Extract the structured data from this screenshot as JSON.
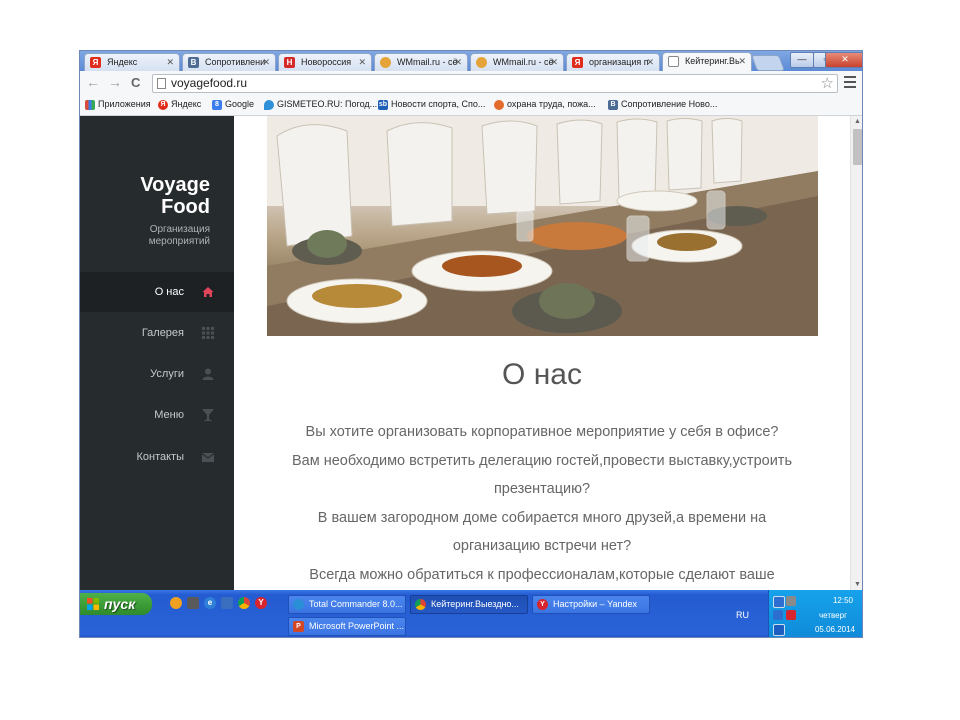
{
  "tabs": [
    {
      "title": "Яндекс",
      "icon": "yandex-icon",
      "color": "#e22c1b"
    },
    {
      "title": "Сопротивление",
      "icon": "vk-icon",
      "color": "#4c6c95"
    },
    {
      "title": "Новороссия",
      "icon": "h-site-icon",
      "color": "#d42a2a"
    },
    {
      "title": "WMmail.ru - сё",
      "icon": "wmmail-icon",
      "color": "#e5a43a"
    },
    {
      "title": "WMmail.ru - сё",
      "icon": "wmmail-icon",
      "color": "#e5a43a"
    },
    {
      "title": "организация п",
      "icon": "yandex-icon",
      "color": "#e22c1b"
    },
    {
      "title": "Кейтеринг.Вь",
      "icon": "page-icon",
      "color": "#888888",
      "active": true
    }
  ],
  "window_controls": {
    "minimize": "—",
    "maximize": "▫",
    "close": "✕"
  },
  "toolbar": {
    "back": "←",
    "forward": "→",
    "reload": "C",
    "url": "voyagefood.ru",
    "star": "☆"
  },
  "bookmarks": [
    {
      "label": "Приложения",
      "icon": "apps-icon",
      "color": "#d84c3a"
    },
    {
      "label": "Яндекс",
      "icon": "yandex-icon",
      "color": "#e22c1b"
    },
    {
      "label": "Google",
      "icon": "google-icon",
      "color": "#3b7ded"
    },
    {
      "label": "GISMETEO.RU: Погод...",
      "icon": "gismeteo-icon",
      "color": "#2f8fd8"
    },
    {
      "label": "Новости спорта, Спо...",
      "icon": "sports-icon",
      "color": "#1f5fb5"
    },
    {
      "label": "охрана труда, пожа...",
      "icon": "safety-icon",
      "color": "#e36b2c"
    },
    {
      "label": "Сопротивление Ново...",
      "icon": "vk-icon",
      "color": "#4c6c95"
    }
  ],
  "site": {
    "brand_line1": "Voyage",
    "brand_line2": "Food",
    "brand_sub_line1": "Организация",
    "brand_sub_line2": "мероприятий",
    "nav": [
      {
        "label": "О нас",
        "icon": "home-icon",
        "active": true
      },
      {
        "label": "Галерея",
        "icon": "grid-icon"
      },
      {
        "label": "Услуги",
        "icon": "user-icon"
      },
      {
        "label": "Меню",
        "icon": "cocktail-icon"
      },
      {
        "label": "Контакты",
        "icon": "envelope-icon"
      }
    ],
    "heading": "О нас",
    "paragraph_lines": [
      "Вы хотите организовать корпоративное мероприятие у себя в офисе?",
      "Вам необходимо встретить делегацию гостей,провести выставку,устроить",
      "презентацию?",
      "В вашем загородном доме собирается много друзей,а времени на",
      "организацию встречи нет?",
      "Всегда можно обратиться к профессионалам,которые сделают ваше"
    ],
    "accent": "#e0455a"
  },
  "taskbar": {
    "start_label": "пуск",
    "items": [
      {
        "label": "Total Commander 8.0...",
        "icon": "total-commander-icon",
        "color": "#2a8fd6"
      },
      {
        "label": "Кейтеринг.Выездно...",
        "icon": "chrome-icon",
        "color": "#d9a021",
        "active": true
      },
      {
        "label": "Настройки – Yandex",
        "icon": "yandex-browser-icon",
        "color": "#d8242c"
      },
      {
        "label": "Microsoft PowerPoint ...",
        "icon": "powerpoint-icon",
        "color": "#d24726"
      }
    ],
    "language": "RU",
    "time": "12:50",
    "weekday": "четверг",
    "date": "05.06.2014"
  }
}
